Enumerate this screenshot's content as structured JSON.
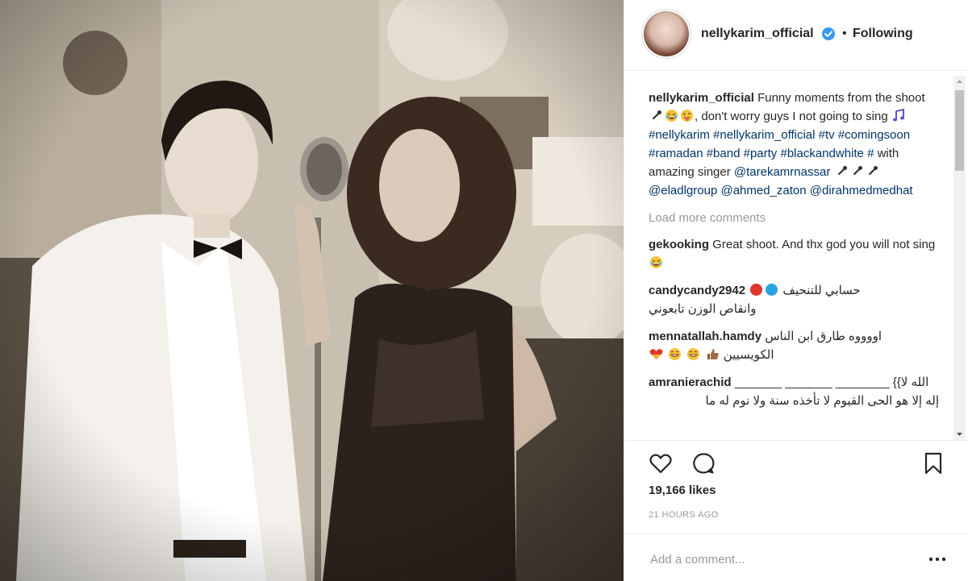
{
  "post": {
    "username": "nellykarim_official",
    "separator": "•",
    "follow_status": "Following"
  },
  "caption": {
    "username": "nellykarim_official",
    "t1": " Funny moments from the shoot ",
    "t2": ", don't worry guys I not going to sing ",
    "h1": "#nellykarim",
    "h2": "#nellykarim_official",
    "h3": "#tv",
    "h4": "#comingsoon",
    "h5": "#ramadan",
    "h6": "#band",
    "h7": "#party",
    "h8": "#blackandwhite",
    "h9": "#",
    "t3": " with amazing singer ",
    "m1": "@tarekamrnassar",
    "m2": "@eladlgroup",
    "m3": "@ahmed_zaton",
    "m4": "@dirahmedmedhat"
  },
  "load_more": "Load more comments",
  "comments": [
    {
      "username": "gekooking",
      "text": " Great shoot. And thx god you will not sing "
    },
    {
      "username": "candycandy2942",
      "text_rtl_1": "حسابي للتنحيف",
      "text_rtl_2": "وانقاص الوزن تابعوني"
    },
    {
      "username": "mennatallah.hamdy",
      "text_rtl_1": "اووووه طارق ابن الناس",
      "text_rtl_2": "الكويسيين"
    },
    {
      "username": "amranierachid",
      "text": " _______ _______ ________ {{الله لا",
      "text_rtl_2": "إله إلا هو الحى القيوم لا تأخذه سنة ولا نوم له ما"
    }
  ],
  "likes": "19,166 likes",
  "time": "21 HOURS AGO",
  "add_comment": {
    "placeholder": "Add a comment..."
  },
  "colors": {
    "hashtag": "#003569",
    "muted": "#999999",
    "verified": "#3897f0",
    "text": "#262626"
  },
  "icons": [
    "verified-badge-icon",
    "heart-icon",
    "comment-bubble-icon",
    "bookmark-icon",
    "more-options-icon",
    "microphone-emoji-icon",
    "laughing-emoji-icon"
  ]
}
